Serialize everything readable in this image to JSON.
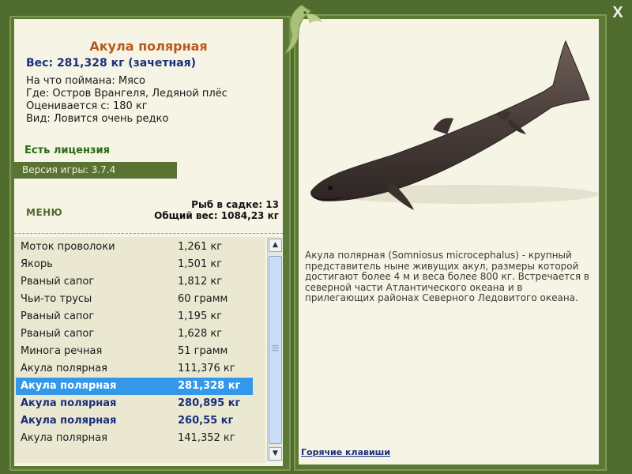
{
  "window": {
    "close_label": "X"
  },
  "fish": {
    "title": "Акула полярная",
    "weight_line": "Вес: 281,328 кг (зачетная)",
    "info": [
      "На что поймана: Мясо",
      "Где: Остров Врангеля, Ледяной плёс",
      "Оценивается с: 180 кг",
      "Вид: Ловится очень редко"
    ],
    "description": "Акула полярная (Somniosus microcephalus) - крупный представитель ныне живущих акул, размеры которой достигают более 4 м и веса более 800 кг. Встречается в северной части Атлантического океана и в прилегающих районах Северного Ледовитого океана."
  },
  "license": "Есть лицензия",
  "version": "Версия игры: 3.7.4",
  "menu_label": "МЕНЮ",
  "stats": {
    "fish_count": "Рыб в садке: 13",
    "total_weight": "Общий вес: 1084,23 кг"
  },
  "catch_list": [
    {
      "name": "Моток проволоки",
      "weight": "1,261 кг",
      "style": "normal"
    },
    {
      "name": "Якорь",
      "weight": "1,501 кг",
      "style": "normal"
    },
    {
      "name": "Рваный сапог",
      "weight": "1,812 кг",
      "style": "normal"
    },
    {
      "name": "Чьи-то трусы",
      "weight": "60 грамм",
      "style": "normal"
    },
    {
      "name": "Рваный сапог",
      "weight": "1,195 кг",
      "style": "normal"
    },
    {
      "name": "Рваный сапог",
      "weight": "1,628 кг",
      "style": "normal"
    },
    {
      "name": "Минога речная",
      "weight": "51 грамм",
      "style": "normal"
    },
    {
      "name": "Акула полярная",
      "weight": "111,376 кг",
      "style": "normal"
    },
    {
      "name": "Акула полярная",
      "weight": "281,328 кг",
      "style": "selected"
    },
    {
      "name": "Акула полярная",
      "weight": "280,895 кг",
      "style": "bold"
    },
    {
      "name": "Акула полярная",
      "weight": "260,55 кг",
      "style": "bold"
    },
    {
      "name": "Акула полярная",
      "weight": "141,352 кг",
      "style": "normal"
    }
  ],
  "hotkeys_label": "Горячие клавиши",
  "colors": {
    "frame": "#4f6b2d",
    "panel": "#f6f4e4",
    "title_orange": "#b85a1c",
    "navy": "#1a2f7c",
    "selection": "#3398ea"
  }
}
